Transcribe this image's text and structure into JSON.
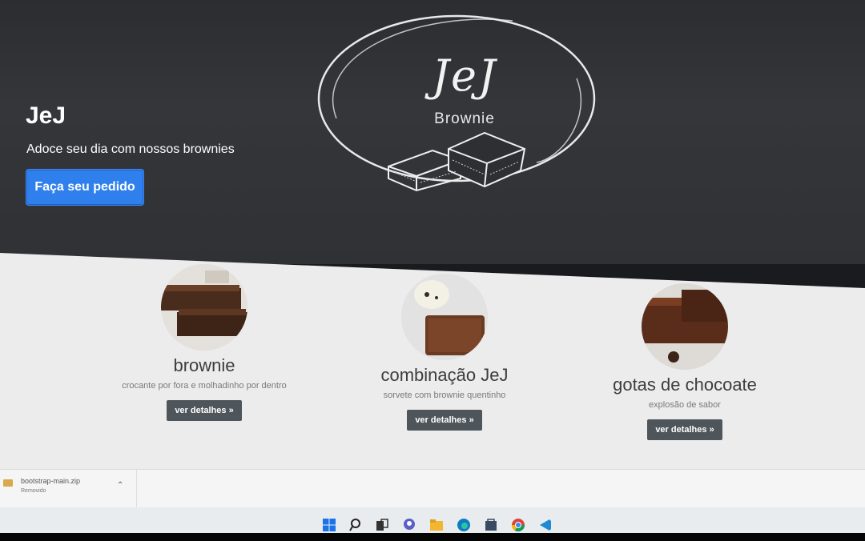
{
  "hero": {
    "brand": "JeJ",
    "tagline": "Adoce seu dia com nossos brownies",
    "cta_label": "Faça seu pedido",
    "logo_title": "JeJ",
    "logo_sub": "Brownie"
  },
  "products": [
    {
      "name": "brownie",
      "description": "crocante por fora e molhadinho por dentro",
      "button": "ver detalhes »"
    },
    {
      "name": "combinação JeJ",
      "description": "sorvete com brownie quentinho",
      "button": "ver detalhes »"
    },
    {
      "name": "gotas de chocoate",
      "description": "explosão de sabor",
      "button": "ver detalhes »"
    }
  ],
  "download": {
    "filename": "bootstrap-main.zip",
    "status": "Removido"
  },
  "taskbar_icons": [
    "windows-icon",
    "search-icon",
    "task-view-icon",
    "chat-icon",
    "folder-icon",
    "edge-icon",
    "store-icon",
    "chrome-icon",
    "vscode-icon"
  ]
}
